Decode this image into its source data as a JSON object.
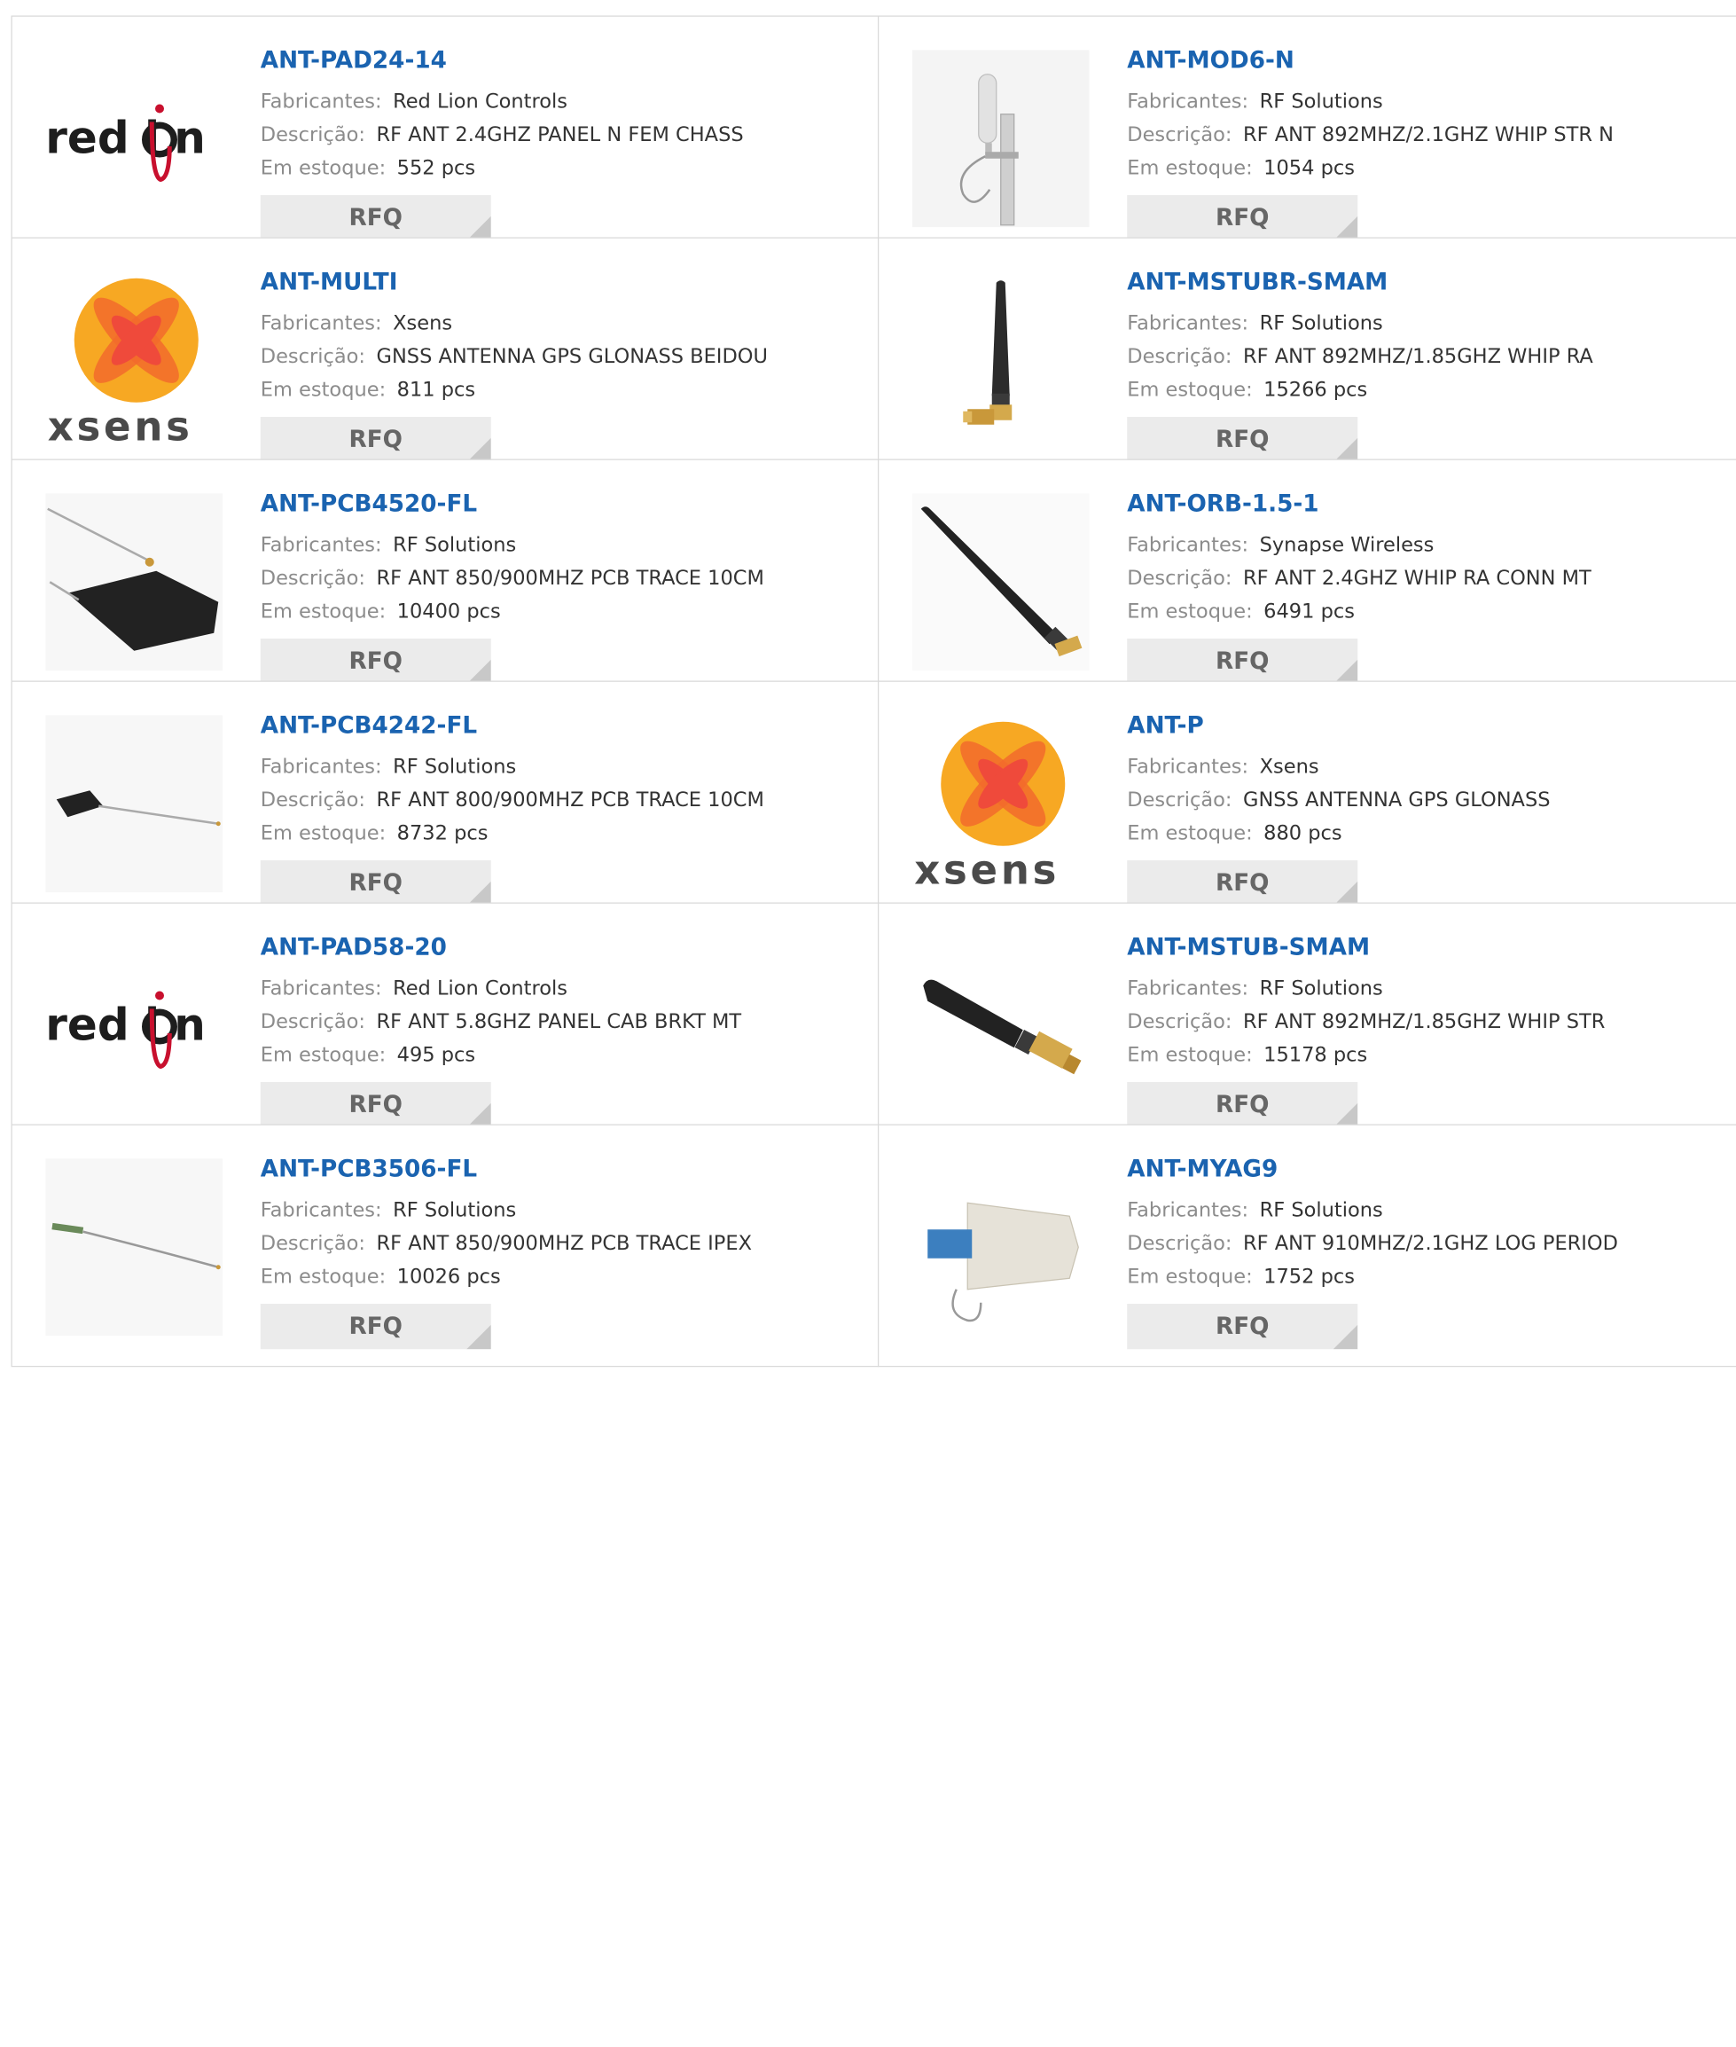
{
  "labels": {
    "manufacturer": "Fabricantes:",
    "description": "Descrição:",
    "stock": "Em estoque:",
    "rfq": "RFQ"
  },
  "products": [
    {
      "pn": "ANT-PAD24-14",
      "mfr": "Red Lion Controls",
      "desc": "RF ANT 2.4GHZ PANEL N FEM CHASS",
      "stock": "552 pcs",
      "image": "red-lion-logo"
    },
    {
      "pn": "ANT-MOD6-N",
      "mfr": "RF Solutions",
      "desc": "RF ANT 892MHZ/2.1GHZ WHIP STR N",
      "stock": "1054 pcs",
      "image": "pole-mount-antenna"
    },
    {
      "pn": "ANT-MULTI",
      "mfr": "Xsens",
      "desc": "GNSS ANTENNA GPS GLONASS BEIDOU",
      "stock": "811 pcs",
      "image": "xsens-logo"
    },
    {
      "pn": "ANT-MSTUBR-SMAM",
      "mfr": "RF Solutions",
      "desc": "RF ANT 892MHZ/1.85GHZ WHIP RA",
      "stock": "15266 pcs",
      "image": "stub-antenna-right-angle"
    },
    {
      "pn": "ANT-PCB4520-FL",
      "mfr": "RF Solutions",
      "desc": "RF ANT 850/900MHZ PCB TRACE 10CM",
      "stock": "10400 pcs",
      "image": "pcb-antenna-black"
    },
    {
      "pn": "ANT-ORB-1.5-1",
      "mfr": "Synapse Wireless",
      "desc": "RF ANT 2.4GHZ WHIP RA CONN MT",
      "stock": "6491 pcs",
      "image": "whip-antenna"
    },
    {
      "pn": "ANT-PCB4242-FL",
      "mfr": "RF Solutions",
      "desc": "RF ANT 800/900MHZ PCB TRACE 10CM",
      "stock": "8732 pcs",
      "image": "pcb-antenna-small"
    },
    {
      "pn": "ANT-P",
      "mfr": "Xsens",
      "desc": "GNSS ANTENNA GPS GLONASS",
      "stock": "880 pcs",
      "image": "xsens-logo"
    },
    {
      "pn": "ANT-PAD58-20",
      "mfr": "Red Lion Controls",
      "desc": "RF ANT 5.8GHZ PANEL CAB BRKT MT",
      "stock": "495 pcs",
      "image": "red-lion-logo"
    },
    {
      "pn": "ANT-MSTUB-SMAM",
      "mfr": "RF Solutions",
      "desc": "RF ANT 892MHZ/1.85GHZ WHIP STR",
      "stock": "15178 pcs",
      "image": "stub-antenna-straight"
    },
    {
      "pn": "ANT-PCB3506-FL",
      "mfr": "RF Solutions",
      "desc": "RF ANT 850/900MHZ PCB TRACE IPEX",
      "stock": "10026 pcs",
      "image": "pcb-trace-wire"
    },
    {
      "pn": "ANT-MYAG9",
      "mfr": "RF Solutions",
      "desc": "RF ANT 910MHZ/2.1GHZ LOG PERIOD",
      "stock": "1752 pcs",
      "image": "log-periodic-antenna"
    }
  ],
  "colors": {
    "link": "#1a63b0",
    "label": "#8c8c8c",
    "button": "#ebebeb",
    "logo_red": "#c8102e",
    "xsens_orange": "#f7941d"
  }
}
